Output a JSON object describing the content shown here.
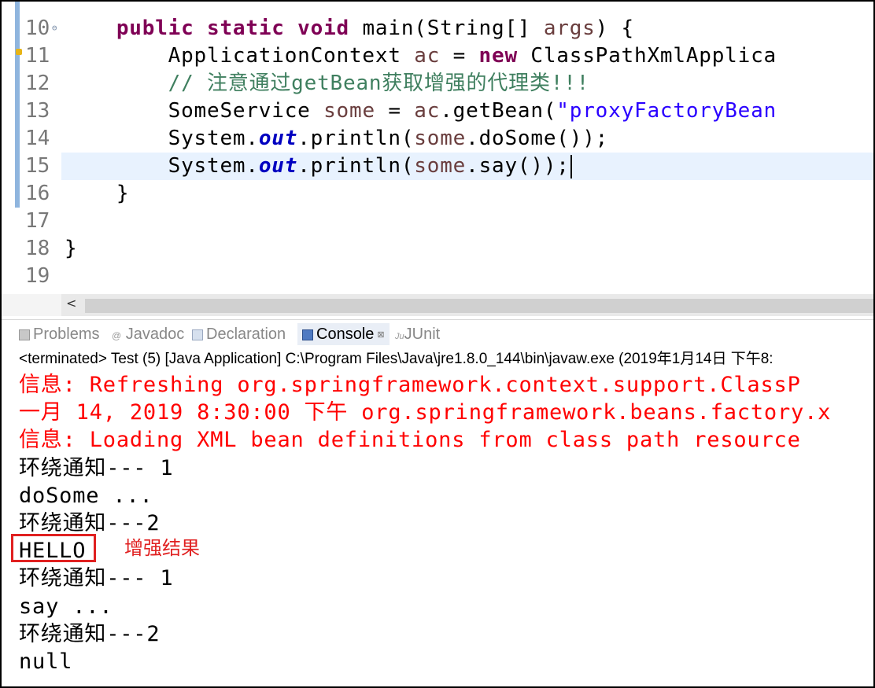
{
  "editor": {
    "lines": [
      {
        "num": "10",
        "parts": [
          {
            "c": "",
            "t": "    "
          },
          {
            "c": "kw",
            "t": "public static void "
          },
          {
            "c": "",
            "t": "main(String[] "
          },
          {
            "c": "var",
            "t": "args"
          },
          {
            "c": "",
            "t": ") {"
          }
        ]
      },
      {
        "num": "11",
        "parts": [
          {
            "c": "",
            "t": "        ApplicationContext "
          },
          {
            "c": "var",
            "t": "ac"
          },
          {
            "c": "",
            "t": " = "
          },
          {
            "c": "kw",
            "t": "new "
          },
          {
            "c": "",
            "t": "ClassPathXmlApplica"
          }
        ]
      },
      {
        "num": "12",
        "parts": [
          {
            "c": "cmt",
            "t": "        // 注意通过getBean获取增强的代理类!!!"
          }
        ]
      },
      {
        "num": "13",
        "parts": [
          {
            "c": "",
            "t": "        SomeService "
          },
          {
            "c": "var",
            "t": "some"
          },
          {
            "c": "",
            "t": " = "
          },
          {
            "c": "var",
            "t": "ac"
          },
          {
            "c": "",
            "t": ".getBean("
          },
          {
            "c": "str",
            "t": "\"proxyFactoryBean"
          }
        ]
      },
      {
        "num": "14",
        "parts": [
          {
            "c": "",
            "t": "        System."
          },
          {
            "c": "fld",
            "t": "out"
          },
          {
            "c": "",
            "t": ".println("
          },
          {
            "c": "var",
            "t": "some"
          },
          {
            "c": "",
            "t": ".doSome());"
          }
        ]
      },
      {
        "num": "15",
        "parts": [
          {
            "c": "",
            "t": "        System."
          },
          {
            "c": "fld",
            "t": "out"
          },
          {
            "c": "",
            "t": ".println("
          },
          {
            "c": "var",
            "t": "some"
          },
          {
            "c": "",
            "t": ".say());"
          }
        ]
      },
      {
        "num": "16",
        "parts": [
          {
            "c": "",
            "t": "    }"
          }
        ]
      },
      {
        "num": "17",
        "parts": []
      },
      {
        "num": "18",
        "parts": [
          {
            "c": "",
            "t": "}"
          }
        ]
      },
      {
        "num": "19",
        "parts": []
      }
    ]
  },
  "scrollbar": {
    "left_arrow": "<"
  },
  "tabs": {
    "problems": "Problems",
    "javadoc": "Javadoc",
    "declaration": "Declaration",
    "console": "Console",
    "console_close": "⊠",
    "junit": "JUnit",
    "junit_icon": "Ju",
    "javadoc_icon": "@"
  },
  "console": {
    "status": "<terminated> Test (5) [Java Application] C:\\Program Files\\Java\\jre1.8.0_144\\bin\\javaw.exe (2019年1月14日 下午8:",
    "lines": [
      {
        "style": "err",
        "text": "信息: Refreshing org.springframework.context.support.ClassP"
      },
      {
        "style": "err",
        "text": "一月 14, 2019 8:30:00 下午 org.springframework.beans.factory.x"
      },
      {
        "style": "err",
        "text": "信息: Loading XML bean definitions from class path resource"
      },
      {
        "style": "norm",
        "text": "环绕通知--- 1"
      },
      {
        "style": "norm",
        "text": "doSome ..."
      },
      {
        "style": "norm",
        "text": "环绕通知---2"
      },
      {
        "style": "norm",
        "text": "HELLO"
      },
      {
        "style": "norm",
        "text": "环绕通知--- 1"
      },
      {
        "style": "norm",
        "text": "say ..."
      },
      {
        "style": "norm",
        "text": "环绕通知---2"
      },
      {
        "style": "norm",
        "text": "null"
      }
    ],
    "annotation": "增强结果"
  }
}
